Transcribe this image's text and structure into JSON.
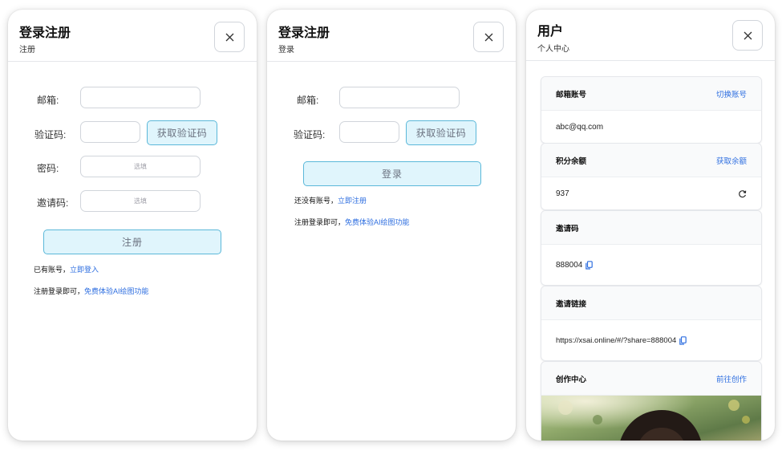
{
  "register_panel": {
    "title": "登录注册",
    "subtitle": "注册",
    "email_label": "邮箱:",
    "code_label": "验证码:",
    "get_code_button": "获取验证码",
    "password_label": "密码:",
    "password_placeholder": "选填",
    "invite_label": "邀请码:",
    "invite_placeholder": "选填",
    "submit_button": "注册",
    "have_account_text": "已有账号，",
    "login_link": "立即登入",
    "promo_text": "注册登录即可，",
    "promo_link": "免费体验AI绘图功能"
  },
  "login_panel": {
    "title": "登录注册",
    "subtitle": "登录",
    "email_label": "邮箱:",
    "code_label": "验证码:",
    "get_code_button": "获取验证码",
    "submit_button": "登录",
    "no_account_text": "还没有账号，",
    "register_link": "立即注册",
    "promo_text": "注册登录即可，",
    "promo_link": "免费体验AI绘图功能"
  },
  "user_panel": {
    "title": "用户",
    "subtitle": "个人中心",
    "email_card": {
      "title": "邮箱账号",
      "action": "切换账号",
      "value": "abc@qq.com"
    },
    "points_card": {
      "title": "积分余额",
      "action": "获取余额",
      "value": "937"
    },
    "invite_code_card": {
      "title": "邀请码",
      "value": "888004"
    },
    "invite_link_card": {
      "title": "邀请链接",
      "value": "https://xsai.online/#/?share=888004"
    },
    "creation_card": {
      "title": "创作中心",
      "action": "前往创作"
    }
  },
  "icons": [
    "close-icon",
    "refresh-icon",
    "copy-icon"
  ],
  "colors": {
    "accent": "#2f6fe0",
    "button_bg": "#e0f5fc",
    "button_border": "#5bb8d9"
  }
}
